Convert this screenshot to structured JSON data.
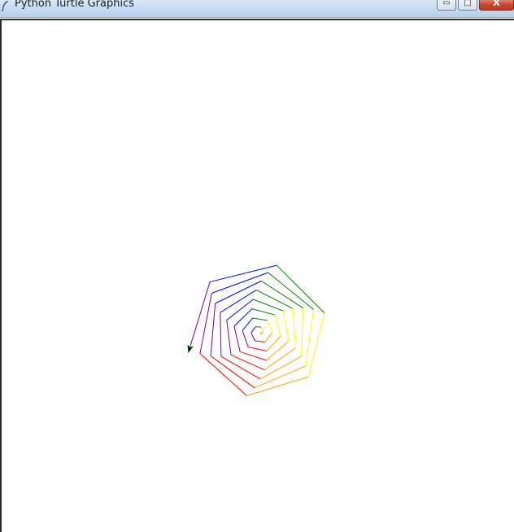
{
  "window": {
    "title": "Python Turtle Graphics",
    "minimize_glyph": "▭",
    "maximize_glyph": "□",
    "close_glyph": "X"
  },
  "drawing": {
    "background": "#ffffff",
    "colors": [
      "#ff0000",
      "#ffa500",
      "#ffff00",
      "#008000",
      "#0000ff",
      "#800080"
    ],
    "turtle_color": "#003300",
    "icons": [
      "feather-icon",
      "turtle-cursor-icon"
    ]
  }
}
